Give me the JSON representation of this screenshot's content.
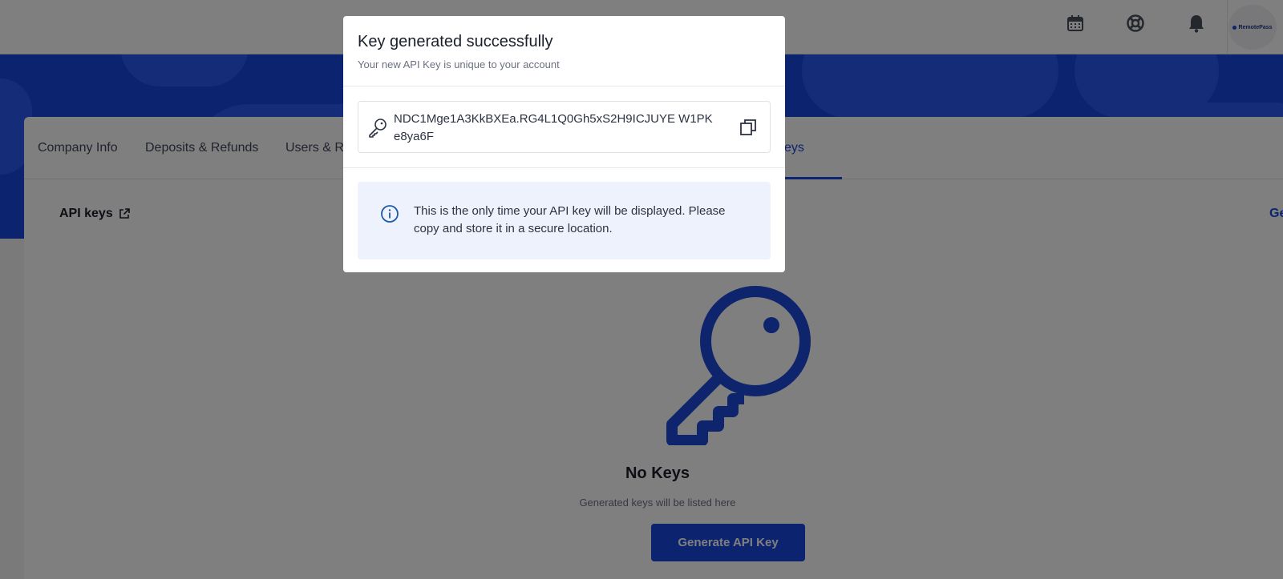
{
  "app": {
    "brand": "RemotePass"
  },
  "tabs": [
    {
      "label": "Company Info"
    },
    {
      "label": "Deposits & Refunds"
    },
    {
      "label": "Users & Re"
    },
    {
      "label": "eys",
      "active": true
    }
  ],
  "section": {
    "title": "API keys",
    "action_label": "Ge"
  },
  "empty_state": {
    "title": "No Keys",
    "subtitle": "Generated keys will be listed here",
    "button_label": "Generate API Key"
  },
  "modal": {
    "title": "Key generated successfully",
    "subtitle": "Your new API Key is unique to your account",
    "api_key": "NDC1Mge1A3KkBXEa.RG4L1Q0Gh5xS2H9ICJUYE W1PKe8ya6F",
    "info_message": "This is the only time your API key will be displayed. Please copy and store it in a secure location."
  },
  "icons": {
    "calendar": "calendar-icon",
    "help": "help-lifebuoy-icon",
    "bell": "bell-icon",
    "key": "key-icon",
    "copy": "copy-icon",
    "info": "info-icon",
    "external_link": "external-link-icon"
  },
  "colors": {
    "primary": "#1847e0",
    "banner": "#1847e0",
    "info_bg": "#eef2fd"
  }
}
